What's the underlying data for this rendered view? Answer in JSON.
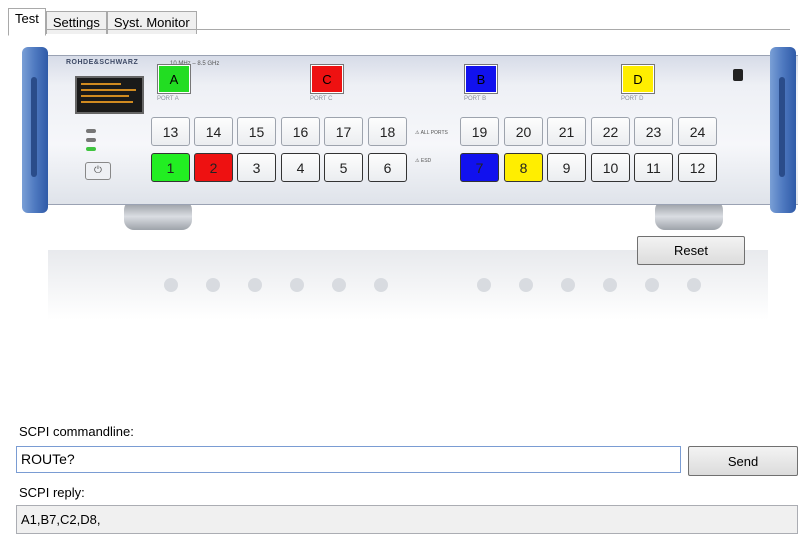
{
  "tabs": [
    {
      "label": "Test",
      "active": true
    },
    {
      "label": "Settings",
      "active": false
    },
    {
      "label": "Syst. Monitor",
      "active": false
    }
  ],
  "device": {
    "brand": "ROHDE&SCHWARZ",
    "frequency": "10 MHz – 8.5 GHz",
    "port_labels": [
      "PORT A",
      "PORT C",
      "PORT B",
      "PORT D"
    ],
    "ports": [
      {
        "label": "A",
        "color": "#22dd22"
      },
      {
        "label": "C",
        "color": "#ee1111"
      },
      {
        "label": "B",
        "color": "#1111ee"
      },
      {
        "label": "D",
        "color": "#ffee00"
      }
    ],
    "top_row": [
      "13",
      "14",
      "15",
      "16",
      "17",
      "18",
      "19",
      "20",
      "21",
      "22",
      "23",
      "24"
    ],
    "bottom_row": [
      {
        "label": "1",
        "color": "#22ee22"
      },
      {
        "label": "2",
        "color": "#ee1111"
      },
      {
        "label": "3",
        "color": ""
      },
      {
        "label": "4",
        "color": ""
      },
      {
        "label": "5",
        "color": ""
      },
      {
        "label": "6",
        "color": ""
      },
      {
        "label": "7",
        "color": "#1111ee"
      },
      {
        "label": "8",
        "color": "#ffee00"
      },
      {
        "label": "9",
        "color": ""
      },
      {
        "label": "10",
        "color": ""
      },
      {
        "label": "11",
        "color": ""
      },
      {
        "label": "12",
        "color": ""
      }
    ],
    "reset_label": "Reset"
  },
  "scpi": {
    "commandline_label": "SCPI commandline:",
    "command_value": "ROUTe?",
    "send_label": "Send",
    "reply_label": "SCPI reply:",
    "reply_value": "A1,B7,C2,D8,"
  }
}
